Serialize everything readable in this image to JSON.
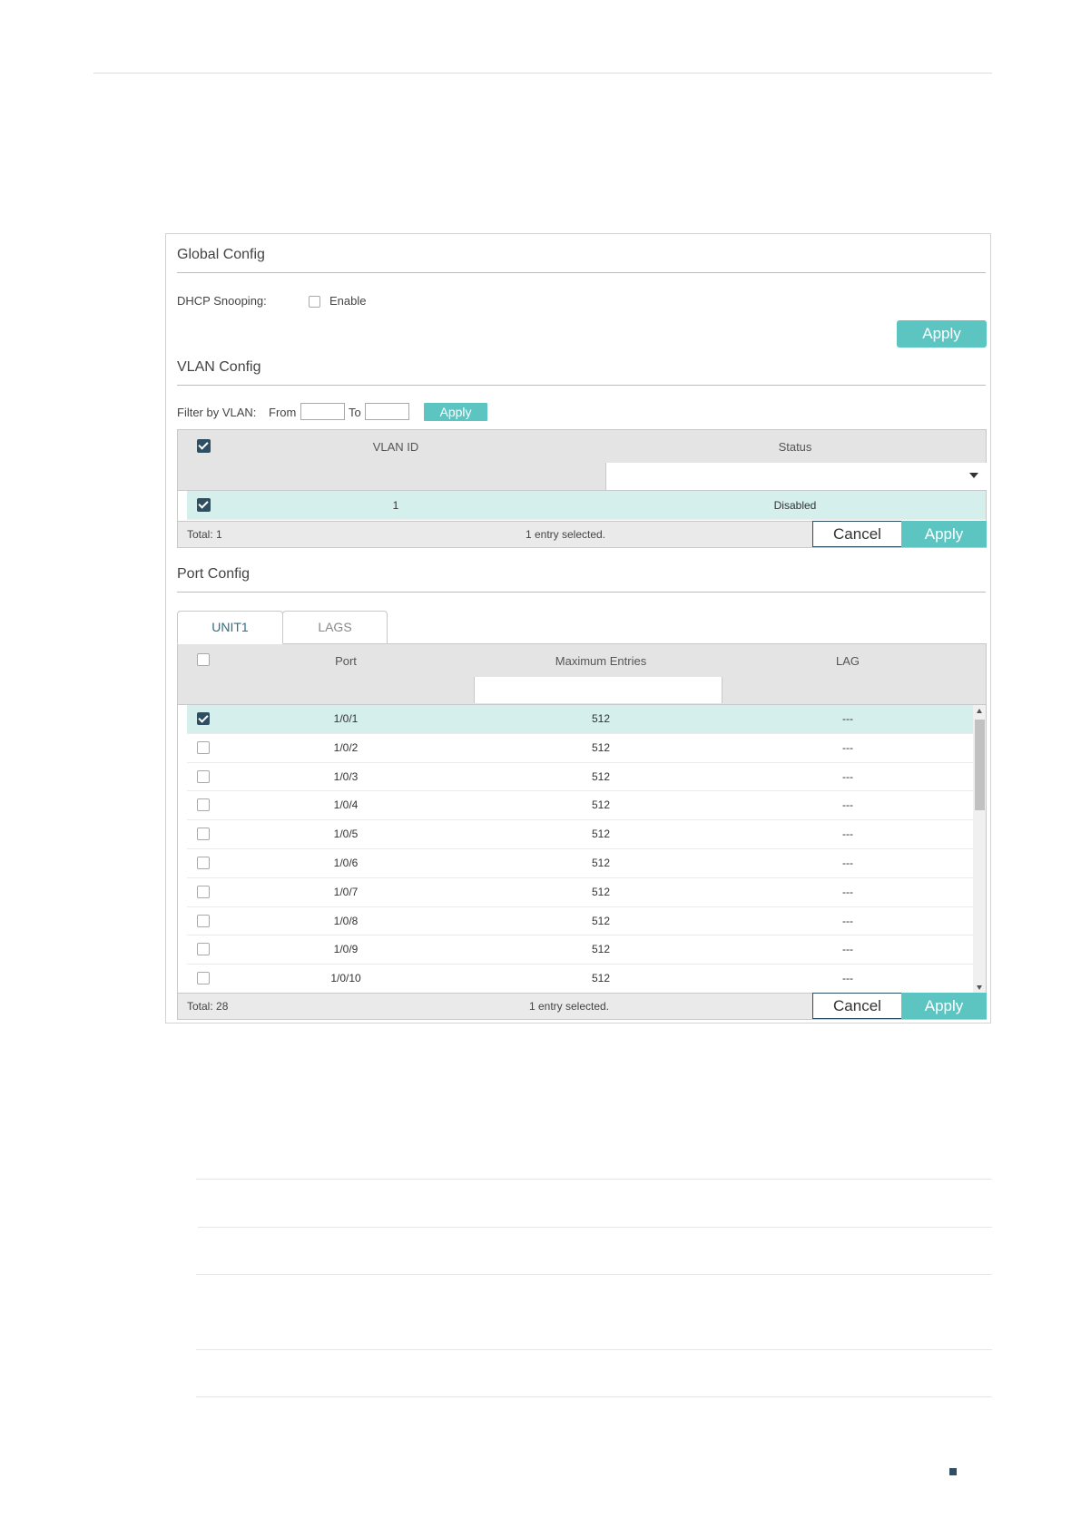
{
  "global_config": {
    "title": "Global Config",
    "dhcp_label": "DHCP Snooping:",
    "enable_label": "Enable",
    "enable_checked": false,
    "apply_label": "Apply"
  },
  "vlan_config": {
    "title": "VLAN Config",
    "filter_label": "Filter by VLAN:",
    "from_label": "From",
    "to_label": "To",
    "from_value": "",
    "to_value": "",
    "filter_apply_label": "Apply",
    "columns": [
      "VLAN ID",
      "Status"
    ],
    "rows": [
      {
        "checked": true,
        "vlan_id": "1",
        "status": "Disabled"
      }
    ],
    "footer_total": "Total: 1",
    "footer_selected": "1 entry selected.",
    "cancel_label": "Cancel",
    "apply_label": "Apply"
  },
  "port_config": {
    "title": "Port Config",
    "tabs": [
      "UNIT1",
      "LAGS"
    ],
    "active_tab": "UNIT1",
    "columns": [
      "Port",
      "Maximum Entries",
      "LAG"
    ],
    "rows": [
      {
        "checked": true,
        "port": "1/0/1",
        "max": "512",
        "lag": "---"
      },
      {
        "checked": false,
        "port": "1/0/2",
        "max": "512",
        "lag": "---"
      },
      {
        "checked": false,
        "port": "1/0/3",
        "max": "512",
        "lag": "---"
      },
      {
        "checked": false,
        "port": "1/0/4",
        "max": "512",
        "lag": "---"
      },
      {
        "checked": false,
        "port": "1/0/5",
        "max": "512",
        "lag": "---"
      },
      {
        "checked": false,
        "port": "1/0/6",
        "max": "512",
        "lag": "---"
      },
      {
        "checked": false,
        "port": "1/0/7",
        "max": "512",
        "lag": "---"
      },
      {
        "checked": false,
        "port": "1/0/8",
        "max": "512",
        "lag": "---"
      },
      {
        "checked": false,
        "port": "1/0/9",
        "max": "512",
        "lag": "---"
      },
      {
        "checked": false,
        "port": "1/0/10",
        "max": "512",
        "lag": "---"
      }
    ],
    "footer_total": "Total: 28",
    "footer_selected": "1 entry selected.",
    "cancel_label": "Cancel",
    "apply_label": "Apply"
  },
  "colors": {
    "accent": "#5cc5c1",
    "checkbox_checked": "#2e4f63",
    "selected_row": "#d5efec"
  }
}
